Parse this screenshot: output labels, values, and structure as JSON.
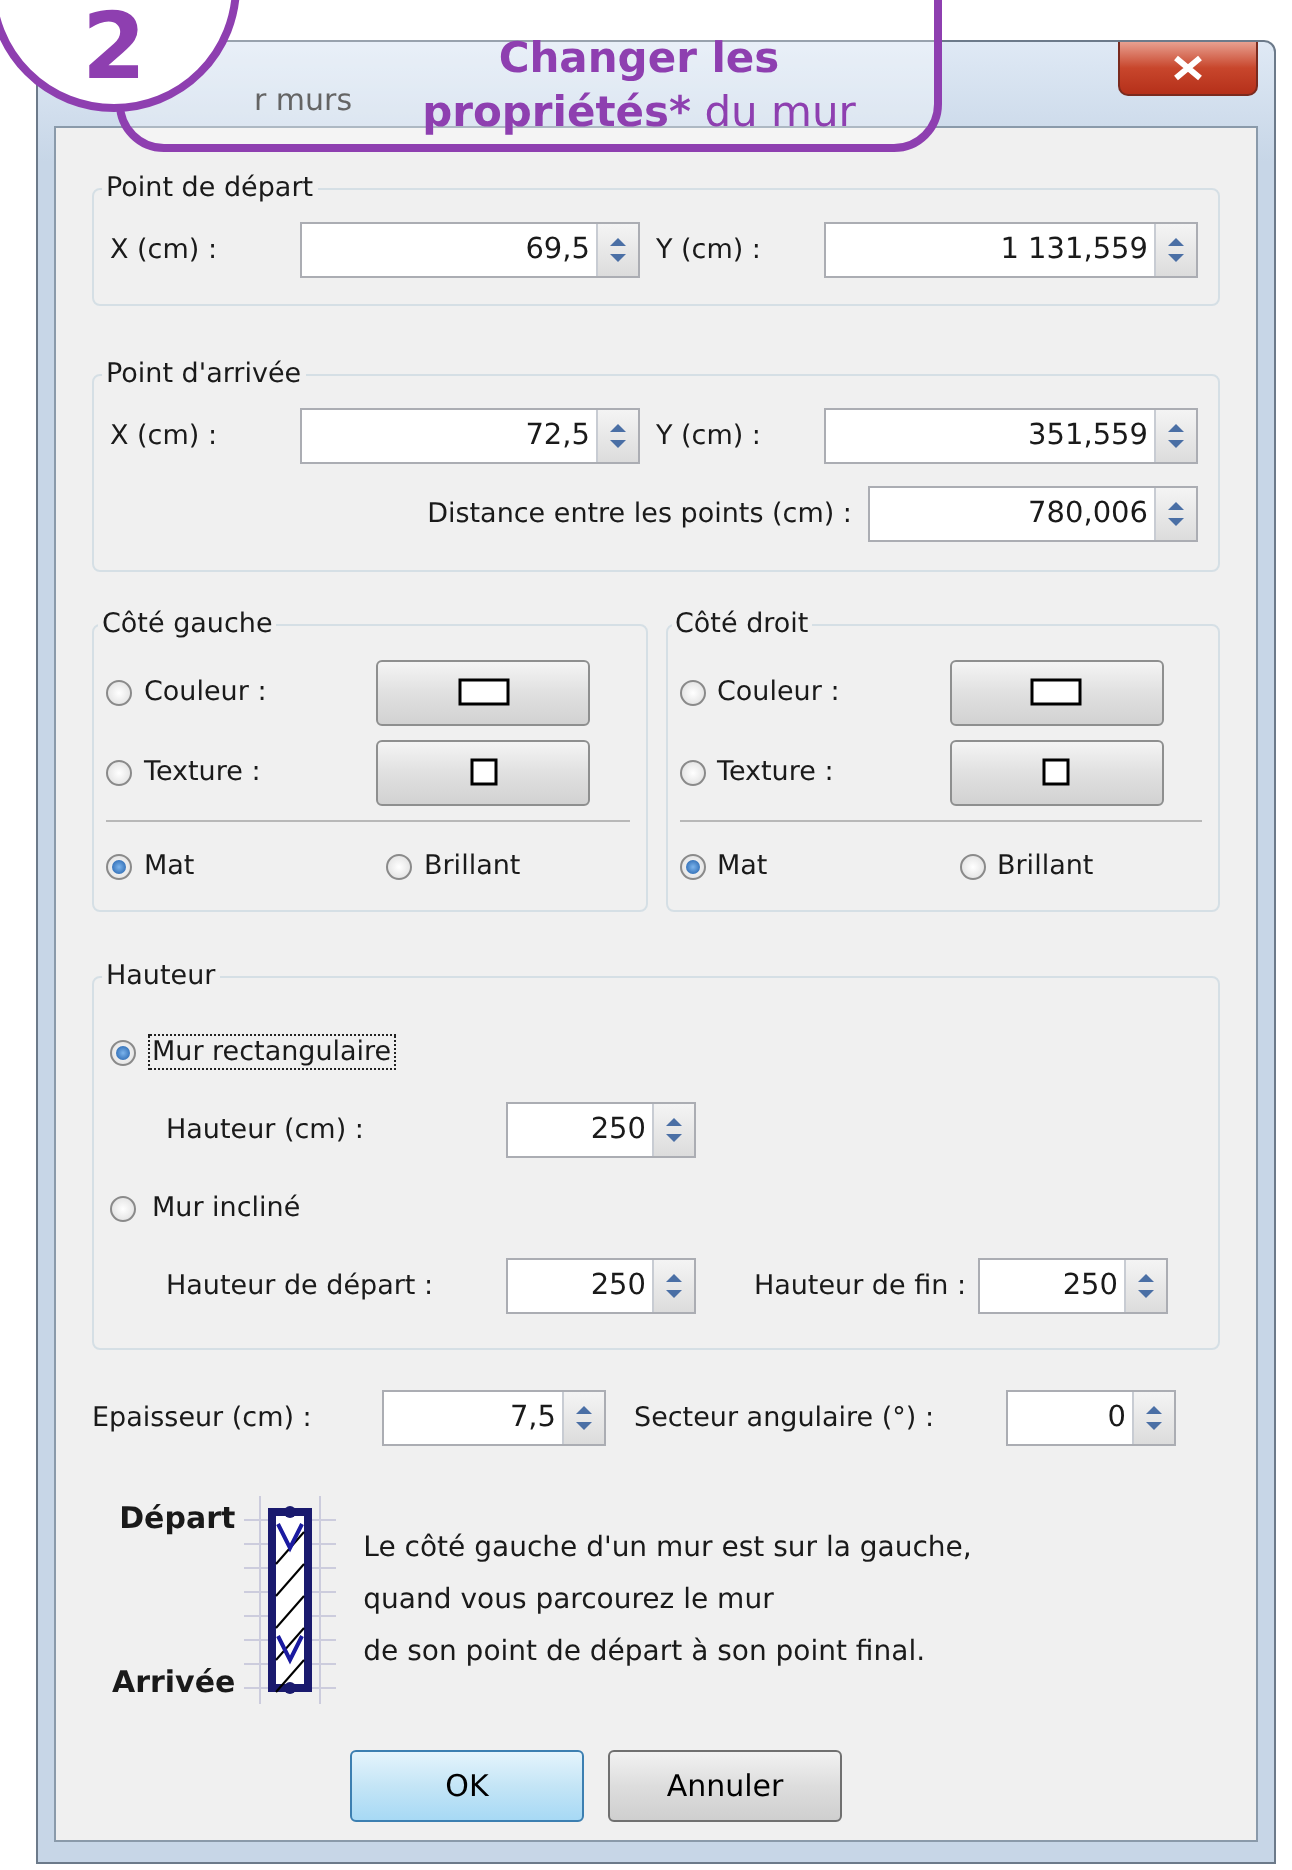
{
  "badge": {
    "number": "2"
  },
  "callout": {
    "emphasis": "Changer les propriétés*",
    "rest": "du mur"
  },
  "window": {
    "title": "r murs"
  },
  "start_point": {
    "legend": "Point de départ",
    "x_label": "X (cm) :",
    "x_value": "69,5",
    "y_label": "Y (cm) :",
    "y_value": "1 131,559"
  },
  "end_point": {
    "legend": "Point d'arrivée",
    "x_label": "X (cm) :",
    "x_value": "72,5",
    "y_label": "Y (cm) :",
    "y_value": "351,559",
    "distance_label": "Distance entre les points (cm) :",
    "distance_value": "780,006"
  },
  "sides": [
    {
      "legend": "Côté gauche",
      "options": [
        {
          "kind": "color",
          "label": "Couleur :",
          "selected": false
        },
        {
          "kind": "texture",
          "label": "Texture :",
          "selected": false
        }
      ],
      "finish": [
        {
          "label": "Mat",
          "selected": true
        },
        {
          "label": "Brillant",
          "selected": false
        }
      ]
    },
    {
      "legend": "Côté droit",
      "options": [
        {
          "kind": "color",
          "label": "Couleur :",
          "selected": false
        },
        {
          "kind": "texture",
          "label": "Texture :",
          "selected": false
        }
      ],
      "finish": [
        {
          "label": "Mat",
          "selected": true
        },
        {
          "label": "Brillant",
          "selected": false
        }
      ]
    }
  ],
  "height": {
    "legend": "Hauteur",
    "modes": [
      {
        "label": "Mur rectangulaire",
        "selected": true,
        "focused": true,
        "fields": [
          {
            "label": "Hauteur (cm) :",
            "value": "250"
          }
        ]
      },
      {
        "label": "Mur incliné",
        "selected": false,
        "focused": false,
        "fields": [
          {
            "label": "Hauteur de départ :",
            "value": "250"
          },
          {
            "label": "Hauteur de fin :",
            "value": "250"
          }
        ]
      }
    ]
  },
  "thickness": {
    "label": "Epaisseur (cm) :",
    "value": "7,5"
  },
  "angle": {
    "label": "Secteur angulaire (°) :",
    "value": "0"
  },
  "legend": {
    "start_label": "Départ",
    "end_label": "Arrivée",
    "note_lines": [
      "Le côté gauche d'un mur est sur la gauche,",
      "quand vous parcourez le mur",
      "de son point de départ à son point final."
    ]
  },
  "buttons": [
    {
      "label": "OK",
      "default": true
    },
    {
      "label": "Annuler",
      "default": false
    }
  ]
}
